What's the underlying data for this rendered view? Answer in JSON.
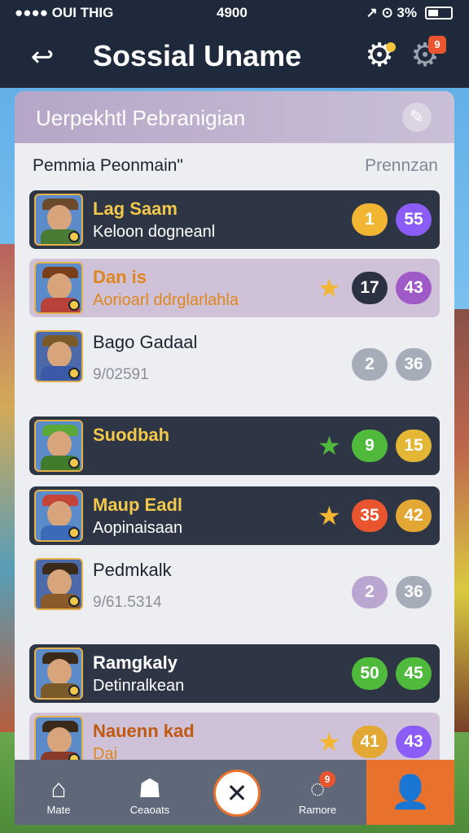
{
  "status": {
    "left": "●●●● OUI THIG",
    "time": "4900",
    "right": "↗ ⊙ 3%"
  },
  "header": {
    "title": "Sossial Uname",
    "back_icon": "↩",
    "gear_icon": "⚙",
    "settings_icon": "⚙",
    "notification_count": "9"
  },
  "panel": {
    "title": "Uerpekhtl Pebranigian",
    "title_icon": "✎",
    "column_left": "Pemmia Peonmain\"",
    "column_right": "Prennzan"
  },
  "rows": [
    {
      "name": "Lag Saam",
      "sub": "Keloon dogneanl",
      "star": "",
      "badge_a": "1",
      "badge_b": "55",
      "style": "dark",
      "colors": {
        "a": "#f2b632",
        "b": "#8b5cf6",
        "name": "#f2c84b",
        "hat": "#6b4a2b",
        "body": "#4a7b34"
      }
    },
    {
      "name": "Dan is",
      "sub": "Aorioarl ddrglarlahla",
      "star": "★",
      "badge_a": "17",
      "badge_b": "43",
      "style": "lilac",
      "colors": {
        "a": "#2b3140",
        "b": "#a05ac8",
        "name": "#e0861f",
        "hat": "#7a3e1a",
        "body": "#b8413a"
      }
    },
    {
      "name": "Bago Gadaal",
      "sub": "9/02591",
      "star": "",
      "badge_a": "2",
      "badge_b": "36",
      "style": "plain",
      "colors": {
        "a": "#a7adb8",
        "b": "#a7adb8",
        "name": "#1d2430",
        "hat": "#7a5a2b",
        "body": "#3a5aa8"
      }
    },
    {
      "name": "Suodbah",
      "sub": "",
      "star": "★",
      "badge_a": "9",
      "badge_b": "15",
      "style": "dark",
      "colors": {
        "a": "#4fba3c",
        "b": "#e3b634",
        "name": "#f2c84b",
        "hat": "#5aa83a",
        "body": "#3f7b2a"
      }
    },
    {
      "name": "Maup Eadl",
      "sub": "Aopinaisaan",
      "star": "★",
      "badge_a": "35",
      "badge_b": "42",
      "style": "dark",
      "colors": {
        "a": "#e8552f",
        "b": "#e3a734",
        "name": "#f2c84b",
        "hat": "#c4443a",
        "body": "#3a6ab8"
      }
    },
    {
      "name": "Pedmkalk",
      "sub": "9/61.5314",
      "star": "",
      "badge_a": "2",
      "badge_b": "36",
      "style": "plain",
      "colors": {
        "a": "#bba6d2",
        "b": "#a7adb8",
        "name": "#1d2430",
        "hat": "#3a2a1a",
        "body": "#8a5a2b"
      }
    },
    {
      "name": "Ramgkaly",
      "sub": "Detinralkean",
      "star": "",
      "badge_a": "50",
      "badge_b": "45",
      "style": "dark",
      "colors": {
        "a": "#4fba3c",
        "b": "#4fba3c",
        "name": "#ffffff",
        "hat": "#3a2a1a",
        "body": "#7a5a2b"
      }
    },
    {
      "name": "Nauenn kad",
      "sub": "Dai",
      "star": "★",
      "badge_a": "41",
      "badge_b": "43",
      "style": "lilac",
      "colors": {
        "a": "#e3a734",
        "b": "#8b5cf6",
        "name": "#c05a12",
        "hat": "#3a2a1a",
        "body": "#8a3a2a"
      }
    }
  ],
  "nav": {
    "items": [
      {
        "label": "Mate",
        "icon": "⌂"
      },
      {
        "label": "Ceaoats",
        "icon": "☗"
      },
      {
        "label": "Ramore",
        "icon": "◌"
      }
    ],
    "center_icon": "✕",
    "badge": "9",
    "profile_icon": "👤"
  }
}
